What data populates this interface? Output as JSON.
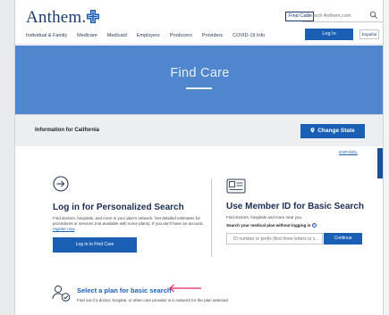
{
  "header": {
    "logo_text": "Anthem.",
    "find_care_label": "Find Care",
    "search_placeholder": "Search Anthem.com",
    "nav_items": [
      "Individual & Family",
      "Medicare",
      "Medicaid",
      "Employers",
      "Producers",
      "Providers",
      "COVID-19 Info"
    ],
    "login_label": "Log In",
    "espanol_label": "Español"
  },
  "hero": {
    "title": "Find Care"
  },
  "state_bar": {
    "info_text": "Information for California",
    "change_state_label": "Change State"
  },
  "espanol_link": "ESPAÑOL",
  "personalized": {
    "title": "Log in for Personalized Search",
    "desc_1": "Find doctors, hospitals, and more in your plan's network. Get detailed estimates for procedures or services (not available with some plans). If you don't have an account,",
    "register_link": "register now",
    "desc_2": ".",
    "button_label": "Log in to Find Care"
  },
  "member_id": {
    "title": "Use Member ID for Basic Search",
    "desc": "Find doctors, hospitals and more near you.",
    "search_label": "Search your medical plan without logging in",
    "input_placeholder": "ID number or prefix (first three letters or s...",
    "continue_label": "Continue"
  },
  "plan_select": {
    "link_text": "Select a plan for basic search",
    "desc": "Find out if a doctor, hospital, or other care provider is in network for the plan selected."
  },
  "colors": {
    "brand_blue": "#1a5fb4",
    "hero_blue": "#4f86cd",
    "heading_navy": "#1a2e55",
    "annotation_red": "#e0245e"
  },
  "icons": [
    "anthem-cross-icon",
    "search-icon",
    "location-pin-icon",
    "arrow-circle-icon",
    "id-card-icon",
    "help-icon",
    "people-icon",
    "annotation-arrow-icon"
  ]
}
